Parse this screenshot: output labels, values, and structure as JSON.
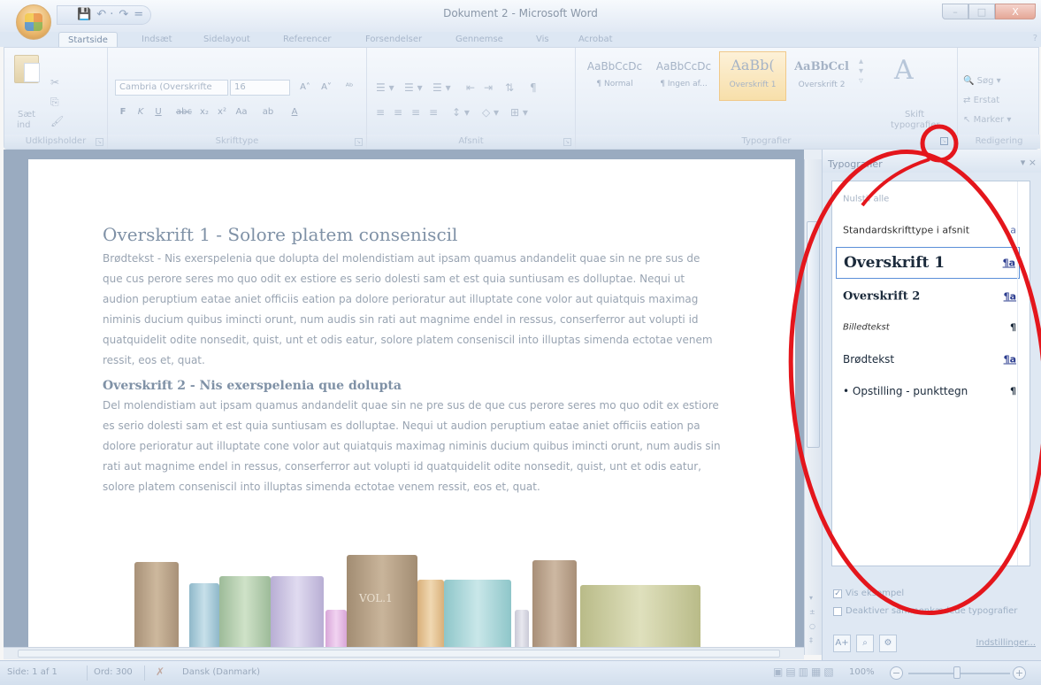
{
  "window": {
    "title": "Dokument 2 - Microsoft Word",
    "controls": {
      "minimize": "–",
      "maximize": "□",
      "close": "X"
    }
  },
  "qat": {
    "save": "💾",
    "undo": "↶ ·",
    "redo": "↷",
    "more": "="
  },
  "tabs": [
    "Startside",
    "Indsæt",
    "Sidelayout",
    "Referencer",
    "Forsendelser",
    "Gennemse",
    "Vis",
    "Acrobat"
  ],
  "help": "?",
  "ribbon": {
    "clipboard": {
      "label": "Udklipsholder",
      "paste": "Sæt",
      "paste2": "ind",
      "cut": "✂",
      "copy": "⎘",
      "format_painter": "🖌"
    },
    "font": {
      "label": "Skrifttype",
      "font_name": "Cambria (Overskrifte",
      "font_size": "16",
      "grow": "A˄",
      "shrink": "A˅",
      "clear": "ᴬᵇ",
      "bold": "F",
      "italic": "K",
      "underline": "U",
      "strike": "abc",
      "subscript": "x₂",
      "superscript": "x²",
      "case": "Aa",
      "highlight": "ab",
      "color": "A"
    },
    "paragraph": {
      "label": "Afsnit",
      "pilcrow": "¶"
    },
    "styles": {
      "label": "Typografier",
      "gallery": [
        {
          "sample": "AaBbCcDc",
          "name": "¶ Normal"
        },
        {
          "sample": "AaBbCcDc",
          "name": "¶ Ingen af..."
        },
        {
          "sample": "AaBb(",
          "name": "Overskrift 1"
        },
        {
          "sample": "AaBbCcl",
          "name": "Overskrift 2"
        }
      ],
      "change_styles_1": "Skift",
      "change_styles_2": "typografier"
    },
    "editing": {
      "label": "Redigering",
      "find": "Søg",
      "replace": "Erstat",
      "select": "Marker"
    }
  },
  "document": {
    "h1": "Overskrift 1 - Solore platem conseniscil",
    "p1": "Brødtekst - Nis exerspelenia que dolupta del molendistiam aut ipsam quamus andandelit quae sin ne pre sus de que cus perore seres mo quo odit ex estiore es serio dolesti sam et est quia suntiusam es dolluptae. Nequi ut audion peruptium eatae aniet officiis eation pa dolore perioratur aut illuptate cone volor aut quiatquis maximag niminis ducium quibus imincti orunt, num audis sin rati aut magnime endel in ressus, conserferror aut volupti id quatquidelit odite nonsedit, quist, unt et odis eatur, solore platem conseniscil into illuptas simenda ectotae venem ressit, eos et, quat.",
    "h2": "Overskrift 2 - Nis exerspelenia que dolupta",
    "p2": "Del molendistiam aut ipsam quamus andandelit quae sin ne pre sus de que cus perore seres mo quo odit ex estiore es serio dolesti sam et est quia suntiusam es dolluptae. Nequi ut audion peruptium eatae aniet officiis eation pa dolore perioratur aut illuptate cone volor aut quiatquis maximag niminis ducium quibus imincti orunt, num audis sin rati aut magnime endel in ressus, conserferror aut volupti id quatquidelit odite nonsedit, quist, unt et odis eatur, solore platem conseniscil into illuptas simenda ectotae venem ressit, eos et, quat.",
    "book_label": "VOL.1"
  },
  "styles_pane": {
    "title": "Typografier",
    "controls": "▾ ×",
    "items": [
      {
        "name": "Nulstil alle",
        "glyph": ""
      },
      {
        "name": "Standardskrifttype i afsnit",
        "glyph": "a"
      },
      {
        "name": "Overskrift 1",
        "glyph": "¶a"
      },
      {
        "name": "Overskrift 2",
        "glyph": "¶a"
      },
      {
        "name": "Billedtekst",
        "glyph": "¶"
      },
      {
        "name": "Brødtekst",
        "glyph": "¶a"
      },
      {
        "name": "• Opstilling - punkttegn",
        "glyph": "¶"
      }
    ],
    "show_preview": "Vis eksempel",
    "show_preview_checked": "✓",
    "disable_linked": "Deaktiver sammenkædede typografier",
    "options": "Indstillinger..."
  },
  "status": {
    "page": "Side: 1 af 1",
    "words": "Ord: 300",
    "language": "Dansk (Danmark)",
    "zoom": "100%"
  },
  "callout_color": "#e4161c"
}
